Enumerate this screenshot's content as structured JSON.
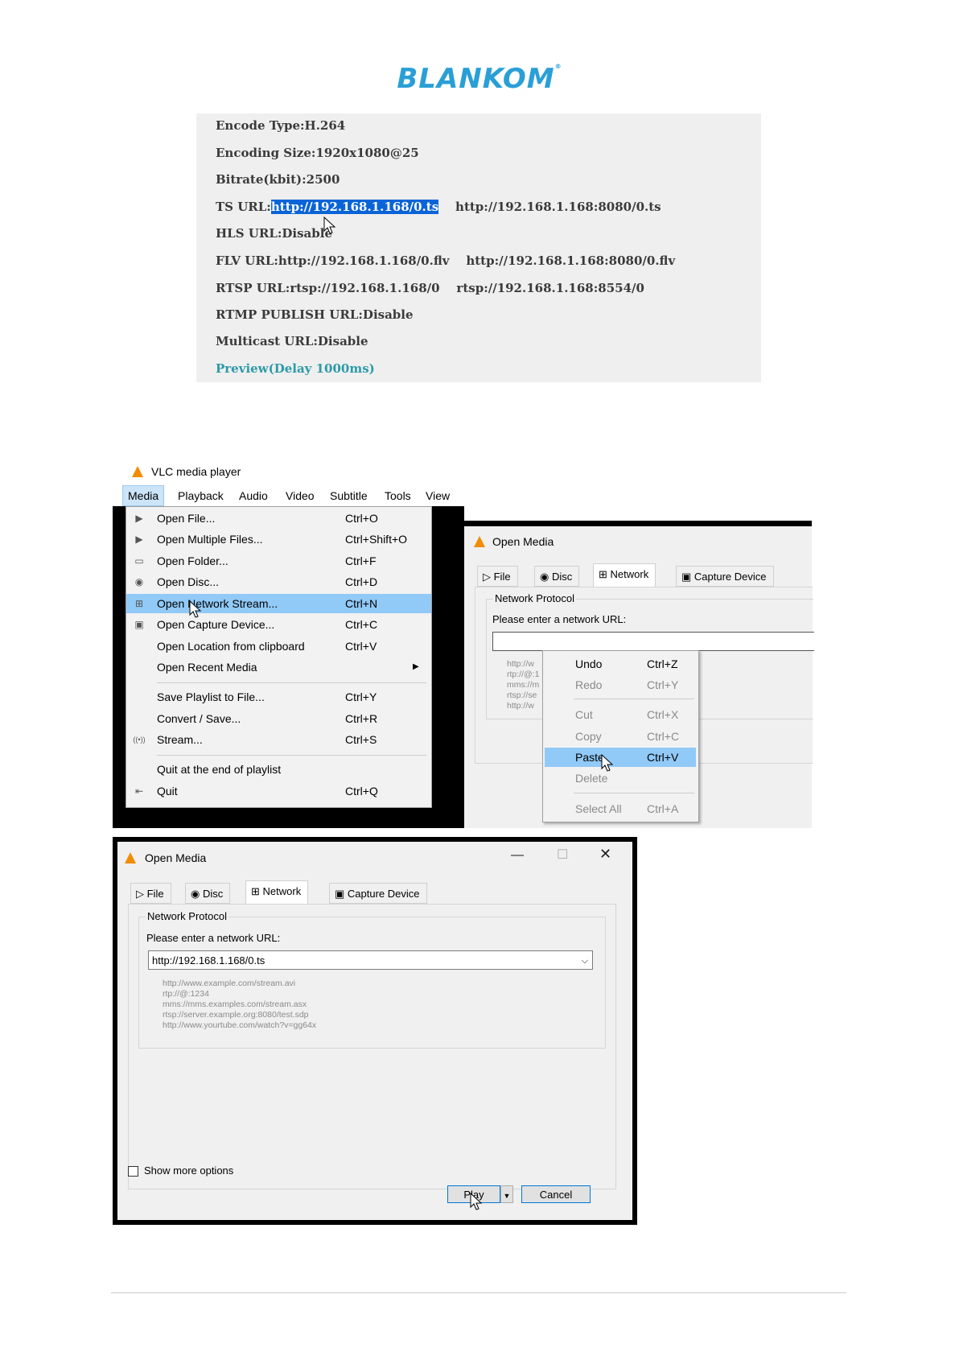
{
  "logo": {
    "text": "BLANKOM",
    "mark": "®"
  },
  "encoder": {
    "lines": [
      "Encode Type:H.264",
      "Encoding Size:1920x1080@25",
      "Bitrate(kbit):2500",
      "HLS URL:Disable",
      "FLV URL:http://192.168.1.168/0.flv    http://192.168.1.168:8080/0.flv",
      "RTSP URL:rtsp://192.168.1.168/0    rtsp://192.168.1.168:8554/0",
      "RTMP PUBLISH URL:Disable",
      "Multicast URL:Disable"
    ],
    "ts_label": "TS URL:",
    "ts_selected": "http://192.168.1.168/0.ts",
    "ts_alt": "http://192.168.1.168:8080/0.ts",
    "preview": "Preview(Delay 1000ms)"
  },
  "vlc": {
    "title": "VLC media player",
    "menus": [
      "Media",
      "Playback",
      "Audio",
      "Video",
      "Subtitle",
      "Tools",
      "View"
    ],
    "media_items": [
      {
        "label": "Open File...",
        "shortcut": "Ctrl+O",
        "icon": "file-icon"
      },
      {
        "label": "Open Multiple Files...",
        "shortcut": "Ctrl+Shift+O",
        "icon": "files-icon"
      },
      {
        "label": "Open Folder...",
        "shortcut": "Ctrl+F",
        "icon": "folder-icon"
      },
      {
        "label": "Open Disc...",
        "shortcut": "Ctrl+D",
        "icon": "disc-icon"
      },
      {
        "label": "Open Network Stream...",
        "shortcut": "Ctrl+N",
        "icon": "network-icon"
      },
      {
        "label": "Open Capture Device...",
        "shortcut": "Ctrl+C",
        "icon": "capture-icon"
      },
      {
        "label": "Open Location from clipboard",
        "shortcut": "Ctrl+V",
        "icon": ""
      },
      {
        "label": "Open Recent Media",
        "shortcut": "",
        "icon": ""
      },
      {
        "label": "Save Playlist to File...",
        "shortcut": "Ctrl+Y",
        "icon": ""
      },
      {
        "label": "Convert / Save...",
        "shortcut": "Ctrl+R",
        "icon": ""
      },
      {
        "label": "Stream...",
        "shortcut": "Ctrl+S",
        "icon": "stream-icon"
      },
      {
        "label": "Quit at the end of playlist",
        "shortcut": "",
        "icon": ""
      },
      {
        "label": "Quit",
        "shortcut": "Ctrl+Q",
        "icon": "quit-icon"
      }
    ]
  },
  "open_media": {
    "title": "Open Media",
    "tabs": [
      "File",
      "Disc",
      "Network",
      "Capture Device"
    ],
    "group": "Network Protocol",
    "prompt": "Please enter a network URL:",
    "url_value": "http://192.168.1.168/0.ts",
    "hints": "http://www.example.com/stream.avi\nrtp://@:1234\nmms://mms.examples.com/stream.asx\nrtsp://server.example.org:8080/test.sdp\nhttp://www.yourtube.com/watch?v=gg64x",
    "hints_cut": "http://w\nrtp://@:1\nmms://m\nrtsp://se\nhttp://w",
    "show_more": "Show more options",
    "play": "Play",
    "cancel": "Cancel",
    "context": [
      {
        "label": "Undo",
        "shortcut": "Ctrl+Z"
      },
      {
        "label": "Redo",
        "shortcut": "Ctrl+Y"
      },
      {
        "label": "Cut",
        "shortcut": "Ctrl+X"
      },
      {
        "label": "Copy",
        "shortcut": "Ctrl+C"
      },
      {
        "label": "Paste",
        "shortcut": "Ctrl+V"
      },
      {
        "label": "Delete",
        "shortcut": ""
      },
      {
        "label": "Select All",
        "shortcut": "Ctrl+A"
      }
    ]
  }
}
